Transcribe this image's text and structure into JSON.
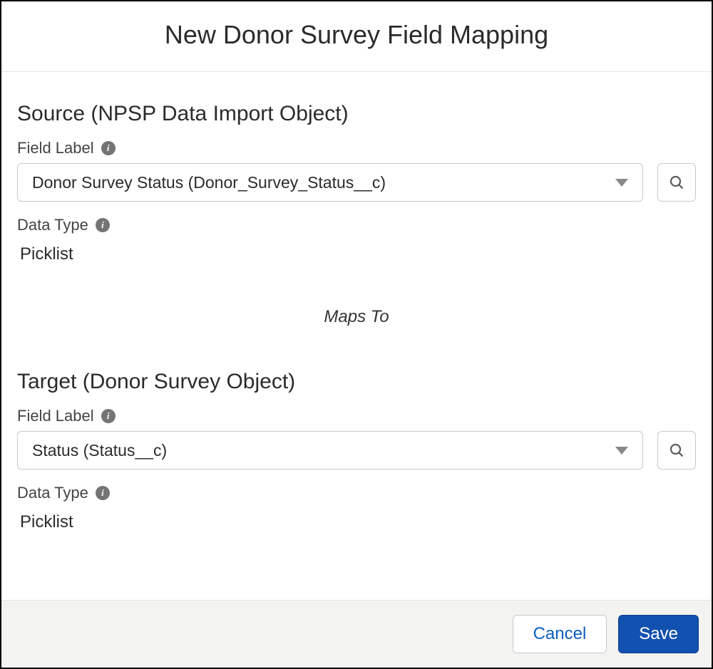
{
  "header": {
    "title": "New Donor Survey Field Mapping"
  },
  "source": {
    "section_title": "Source (NPSP Data Import Object)",
    "field_label_label": "Field Label",
    "field_label_value": "Donor Survey Status (Donor_Survey_Status__c)",
    "data_type_label": "Data Type",
    "data_type_value": "Picklist"
  },
  "maps_to_label": "Maps To",
  "target": {
    "section_title": "Target (Donor Survey Object)",
    "field_label_label": "Field Label",
    "field_label_value": "Status (Status__c)",
    "data_type_label": "Data Type",
    "data_type_value": "Picklist"
  },
  "footer": {
    "cancel_label": "Cancel",
    "save_label": "Save"
  }
}
